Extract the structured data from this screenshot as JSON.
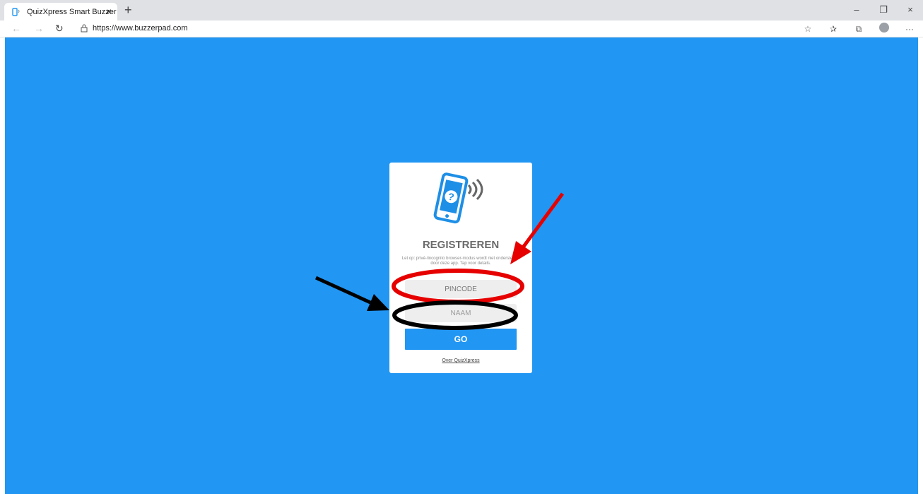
{
  "browser": {
    "tab_title": "QuizXpress Smart Buzzer",
    "tab_close": "×",
    "new_tab": "+",
    "url": "https://www.buzzerpad.com",
    "window_controls": {
      "minimize": "–",
      "restore": "❐",
      "close": "×"
    },
    "nav": {
      "back": "←",
      "forward": "→",
      "refresh": "↻"
    },
    "toolbar_icons": [
      "star-icon",
      "favorites-icon",
      "collections-icon",
      "profile-icon",
      "more-icon"
    ],
    "more": "···"
  },
  "page": {
    "background_color": "#2196f3",
    "card": {
      "title": "REGISTREREN",
      "note": "Let op: privé-/incognito browser-modus wordt niet ondersteund door deze app. Tap voor details.",
      "pincode_placeholder": "PINCODE",
      "naam_placeholder": "NAAM",
      "go_label": "GO",
      "about_link": "Over QuizXpress",
      "accent_color": "#2196f3"
    }
  },
  "annotations": {
    "red_color": "#e60000",
    "black_color": "#000000"
  }
}
